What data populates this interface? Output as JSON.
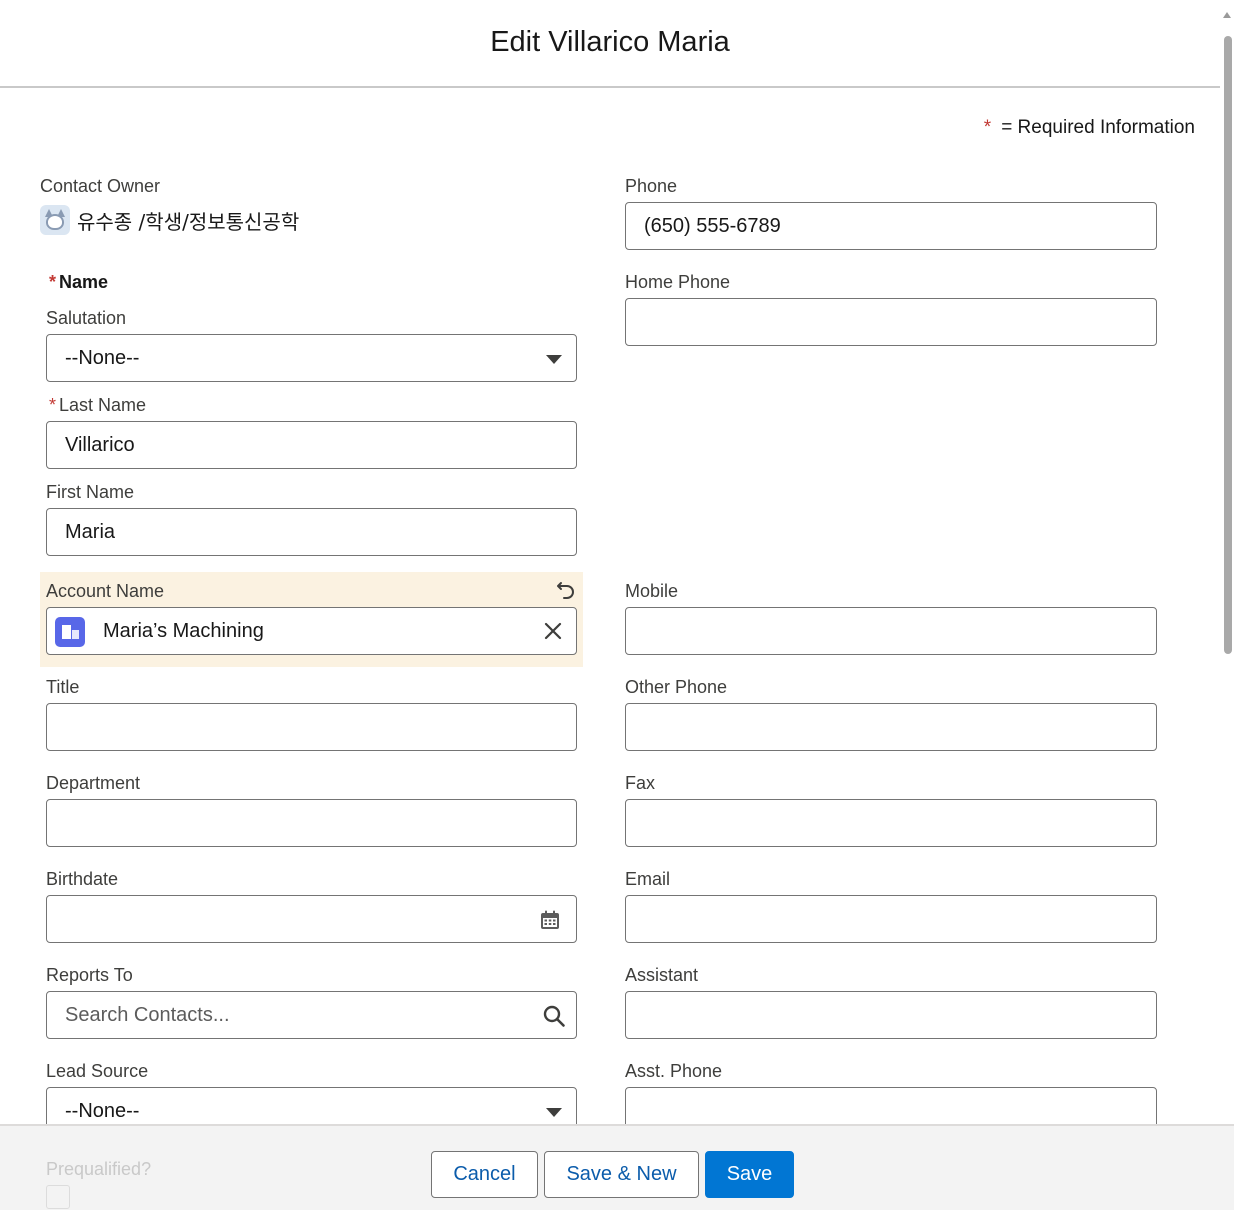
{
  "modal": {
    "title": "Edit Villarico Maria"
  },
  "required_info": {
    "star": "*",
    "text": "= Required Information"
  },
  "contact_owner": {
    "label": "Contact Owner",
    "name": "유수종 /학생/정보통신공학"
  },
  "name_section": {
    "star": "*",
    "label": "Name"
  },
  "salutation": {
    "label": "Salutation",
    "value": "--None--"
  },
  "last_name": {
    "star": "*",
    "label": "Last Name",
    "value": "Villarico"
  },
  "first_name": {
    "label": "First Name",
    "value": "Maria"
  },
  "account_name": {
    "label": "Account Name",
    "value": "Maria’s Machining"
  },
  "title": {
    "label": "Title",
    "value": ""
  },
  "department": {
    "label": "Department",
    "value": ""
  },
  "birthdate": {
    "label": "Birthdate",
    "value": ""
  },
  "reports_to": {
    "label": "Reports To",
    "placeholder": "Search Contacts..."
  },
  "lead_source": {
    "label": "Lead Source",
    "value": "--None--"
  },
  "prequalified": {
    "label": "Prequalified?"
  },
  "phone": {
    "label": "Phone",
    "value": "(650) 555-6789"
  },
  "home_phone": {
    "label": "Home Phone",
    "value": ""
  },
  "mobile": {
    "label": "Mobile",
    "value": ""
  },
  "other_phone": {
    "label": "Other Phone",
    "value": ""
  },
  "fax": {
    "label": "Fax",
    "value": ""
  },
  "email": {
    "label": "Email",
    "value": ""
  },
  "assistant": {
    "label": "Assistant",
    "value": ""
  },
  "asst_phone": {
    "label": "Asst. Phone",
    "value": ""
  },
  "footer": {
    "cancel": "Cancel",
    "save_new": "Save & New",
    "save": "Save"
  },
  "colors": {
    "brand": "#0176d3",
    "required": "#c23934",
    "highlight": "#fbf2e1",
    "account_icon": "#5867e8"
  },
  "icons": [
    "user-avatar-icon",
    "chevron-down-icon",
    "undo-icon",
    "account-icon",
    "close-icon",
    "calendar-icon",
    "search-icon"
  ]
}
